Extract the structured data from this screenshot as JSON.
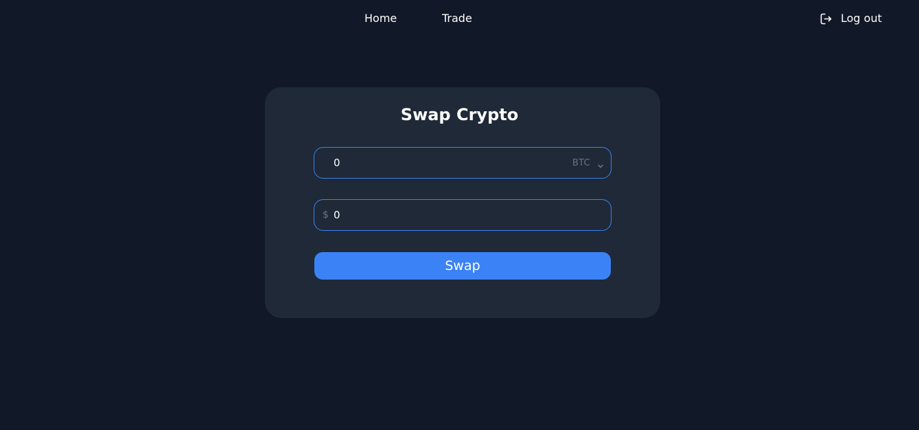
{
  "nav": {
    "home_label": "Home",
    "trade_label": "Trade",
    "logout_label": "Log out",
    "logout_icon": "logout-icon"
  },
  "swap_card": {
    "title": "Swap Crypto",
    "crypto_field": {
      "value": "0",
      "selected_currency": "BTC",
      "dropdown_icon": "chevron-down-icon"
    },
    "usd_field": {
      "currency_symbol": "$",
      "value": "0"
    },
    "swap_button_label": "Swap"
  },
  "colors": {
    "background": "#111827",
    "card_background": "#1f2937",
    "accent": "#3b82f6",
    "muted_text": "#6b7280",
    "text": "#ffffff"
  }
}
